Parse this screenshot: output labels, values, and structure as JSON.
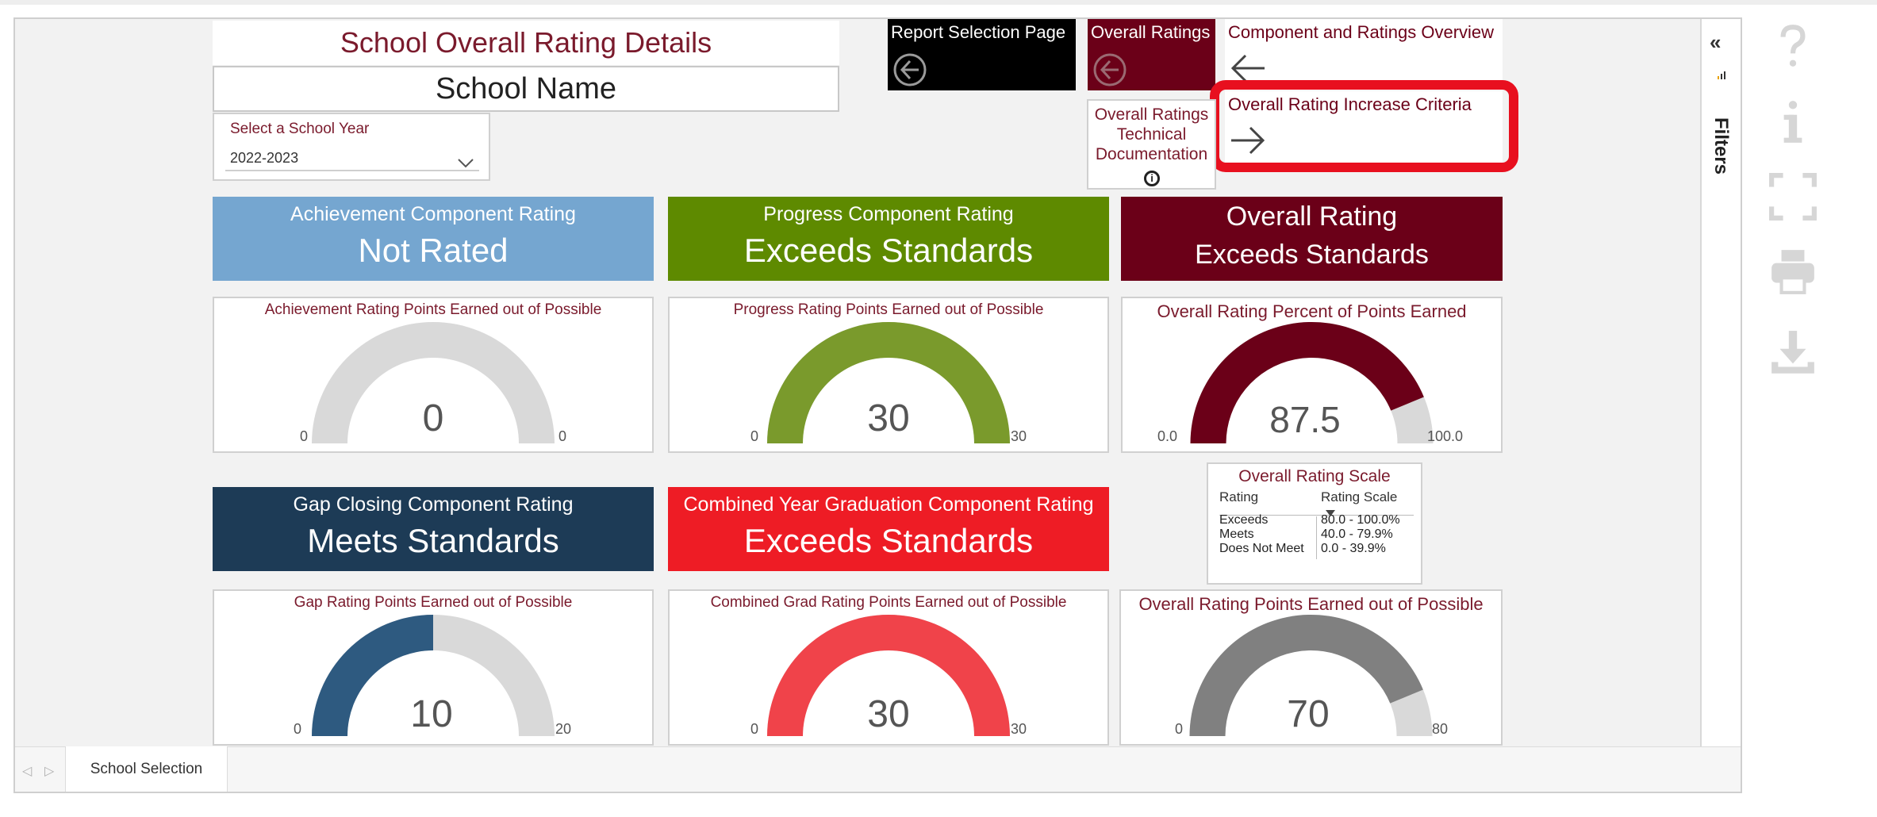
{
  "header": {
    "title": "School Overall Rating Details",
    "school_name": "School Name",
    "year_label": "Select a School Year",
    "year_value": "2022-2023"
  },
  "nav": {
    "report_selection": "Report Selection Page",
    "overall_ratings": "Overall Ratings",
    "component_overview": "Component and Ratings Overview",
    "increase_criteria": "Overall Rating Increase Criteria",
    "tech_doc_line1": "Overall Ratings",
    "tech_doc_line2": "Technical",
    "tech_doc_line3": "Documentation"
  },
  "cards": {
    "achievement": {
      "title": "Achievement Component Rating",
      "value": "Not Rated",
      "color": "#75a6d0"
    },
    "progress": {
      "title": "Progress Component Rating",
      "value": "Exceeds Standards",
      "color": "#5e8a00"
    },
    "overall": {
      "title": "Overall Rating",
      "value": "Exceeds Standards",
      "color": "#6b0018"
    },
    "gap": {
      "title": "Gap Closing Component Rating",
      "value": "Meets Standards",
      "color": "#1d3b56"
    },
    "grad": {
      "title": "Combined Year Graduation Component Rating",
      "value": "Exceeds Standards",
      "color": "#ee1c25"
    }
  },
  "gauges": {
    "achievement": {
      "title": "Achievement Rating Points Earned out of Possible",
      "min": "0",
      "max": "0",
      "value": "0",
      "fraction": 0,
      "fill": "#d9d9d9"
    },
    "progress": {
      "title": "Progress Rating Points Earned out of Possible",
      "min": "0",
      "max": "30",
      "value": "30",
      "fraction": 1,
      "fill": "#7a9a2c"
    },
    "overall_pct": {
      "title": "Overall Rating Percent of Points Earned",
      "min": "0.0",
      "max": "100.0",
      "value": "87.5",
      "fraction": 0.875,
      "fill": "#6b0018"
    },
    "gap": {
      "title": "Gap Rating Points Earned out of Possible",
      "min": "0",
      "max": "20",
      "value": "10",
      "fraction": 0.5,
      "fill": "#2e5a80"
    },
    "grad": {
      "title": "Combined Grad Rating Points Earned out of Possible",
      "min": "0",
      "max": "30",
      "value": "30",
      "fraction": 1,
      "fill": "#f0434a"
    },
    "overall_pts": {
      "title": "Overall Rating Points Earned out of Possible",
      "min": "0",
      "max": "80",
      "value": "70",
      "fraction": 0.875,
      "fill": "#808080"
    }
  },
  "scale": {
    "title": "Overall Rating Scale",
    "col_rating": "Rating",
    "col_scale": "Rating Scale",
    "rows": [
      {
        "rating": "Exceeds",
        "range": "80.0 - 100.0%"
      },
      {
        "rating": "Meets",
        "range": "40.0 - 79.9%"
      },
      {
        "rating": "Does Not Meet",
        "range": "0.0 - 39.9%"
      }
    ]
  },
  "filters": {
    "label": "Filters"
  },
  "tabs": {
    "active": "School Selection"
  },
  "icons": {
    "help": "question-mark-icon",
    "info": "info-icon",
    "fullscreen": "fullscreen-icon",
    "print": "printer-icon",
    "download": "download-icon"
  }
}
